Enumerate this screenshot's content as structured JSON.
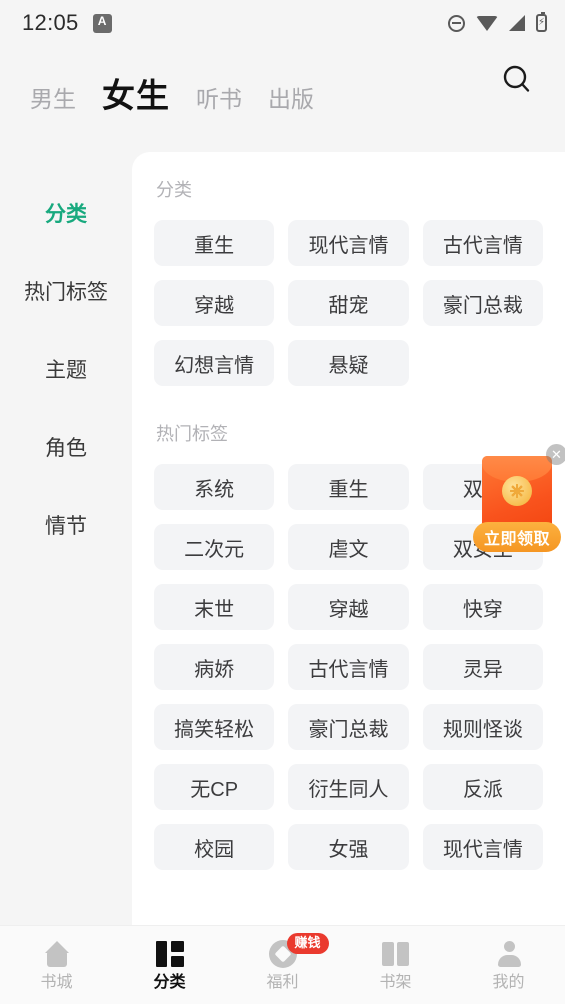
{
  "statusbar": {
    "time": "12:05",
    "app_badge": "A",
    "icons": [
      "dnd-icon",
      "wifi-icon",
      "signal-icon",
      "battery-icon"
    ],
    "battery_glyph": "⚡"
  },
  "topbar": {
    "tabs": [
      {
        "label": "男生",
        "active": false
      },
      {
        "label": "女生",
        "active": true
      },
      {
        "label": "听书",
        "active": false
      },
      {
        "label": "出版",
        "active": false
      }
    ],
    "search_icon": "search-icon"
  },
  "sidebar": {
    "items": [
      {
        "label": "分类",
        "active": true
      },
      {
        "label": "热门标签",
        "active": false
      },
      {
        "label": "主题",
        "active": false
      },
      {
        "label": "角色",
        "active": false
      },
      {
        "label": "情节",
        "active": false
      }
    ]
  },
  "panel": {
    "sections": [
      {
        "title": "分类",
        "chips": [
          "重生",
          "现代言情",
          "古代言情",
          "穿越",
          "甜宠",
          "豪门总裁",
          "幻想言情",
          "悬疑"
        ]
      },
      {
        "title": "热门标签",
        "chips": [
          "系统",
          "重生",
          "双洁",
          "二次元",
          "虐文",
          "双女主",
          "末世",
          "穿越",
          "快穿",
          "病娇",
          "古代言情",
          "灵异",
          "搞笑轻松",
          "豪门总裁",
          "规则怪谈",
          "无CP",
          "衍生同人",
          "反派",
          "校园",
          "女强",
          "现代言情"
        ]
      }
    ]
  },
  "redpacket": {
    "button_label": "立即领取",
    "close_label": "✕",
    "envelope_icon": "red-envelope-icon"
  },
  "bottomnav": {
    "items": [
      {
        "label": "书城",
        "icon": "home-icon",
        "active": false,
        "badge": ""
      },
      {
        "label": "分类",
        "icon": "grid-icon",
        "active": true,
        "badge": ""
      },
      {
        "label": "福利",
        "icon": "coin-icon",
        "active": false,
        "badge": "赚钱"
      },
      {
        "label": "书架",
        "icon": "bookshelf-icon",
        "active": false,
        "badge": ""
      },
      {
        "label": "我的",
        "icon": "person-icon",
        "active": false,
        "badge": ""
      }
    ]
  },
  "colors": {
    "accent_green": "#18a97e",
    "badge_red": "#ea3a2e",
    "packet_orange": "#f59623",
    "chip_bg": "#f3f4f6"
  }
}
